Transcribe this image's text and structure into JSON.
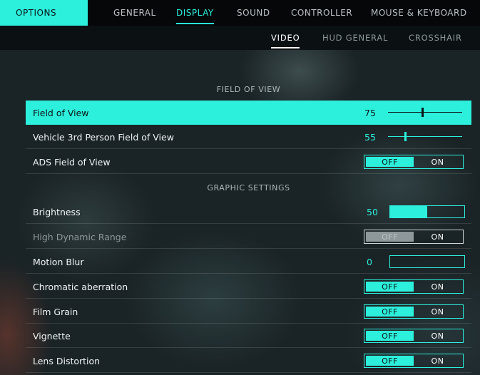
{
  "tabs": {
    "options": "OPTIONS",
    "main": [
      "GENERAL",
      "DISPLAY",
      "SOUND",
      "CONTROLLER",
      "MOUSE & KEYBOARD"
    ],
    "active_main": "DISPLAY",
    "sub": [
      "VIDEO",
      "HUD GENERAL",
      "CROSSHAIR"
    ],
    "active_sub": "VIDEO"
  },
  "sections": {
    "fov_title": "FIELD OF VIEW",
    "graphics_title": "GRAPHIC SETTINGS"
  },
  "settings": {
    "fov": {
      "label": "Field of View",
      "value": "75",
      "level": 0.45
    },
    "vehicle_fov": {
      "label": "Vehicle 3rd Person Field of View",
      "value": "55",
      "level": 0.22
    },
    "ads_fov": {
      "label": "ADS Field of View",
      "off": "OFF",
      "on": "ON",
      "state": "OFF"
    },
    "brightness": {
      "label": "Brightness",
      "value": "50",
      "level": 0.5
    },
    "hdr": {
      "label": "High Dynamic Range",
      "off": "OFF",
      "on": "ON",
      "state": "OFF",
      "disabled": true
    },
    "motion_blur": {
      "label": "Motion Blur",
      "value": "0",
      "level": 0
    },
    "chromatic": {
      "label": "Chromatic aberration",
      "off": "OFF",
      "on": "ON",
      "state": "OFF"
    },
    "film_grain": {
      "label": "Film Grain",
      "off": "OFF",
      "on": "ON",
      "state": "OFF"
    },
    "vignette": {
      "label": "Vignette",
      "off": "OFF",
      "on": "ON",
      "state": "OFF"
    },
    "lens_distortion": {
      "label": "Lens Distortion",
      "off": "OFF",
      "on": "ON",
      "state": "OFF"
    }
  },
  "colors": {
    "accent": "#2cf0dc",
    "background": "#1a2326",
    "topbar": "#050708"
  }
}
